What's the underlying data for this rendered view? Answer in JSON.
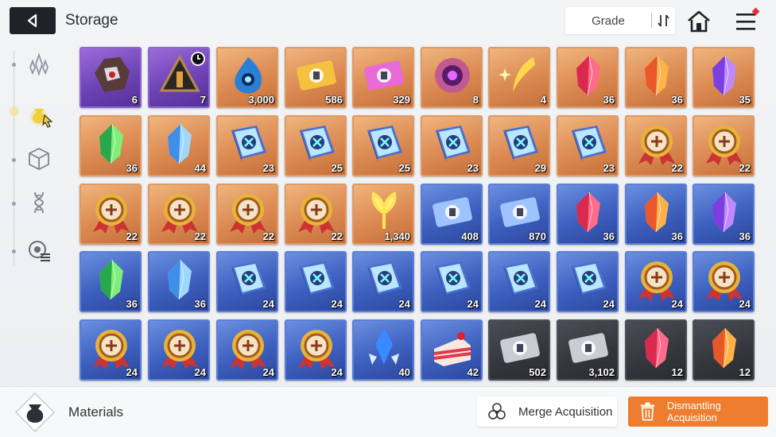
{
  "header": {
    "title": "Storage",
    "sort_label": "Grade"
  },
  "sidebar": {
    "tabs": [
      {
        "icon": "crystal-cluster-icon"
      },
      {
        "icon": "material-pouch-icon",
        "active": true
      },
      {
        "icon": "cube-icon"
      },
      {
        "icon": "dna-icon"
      },
      {
        "icon": "planet-ring-icon"
      }
    ]
  },
  "inventory": {
    "rows": [
      [
        {
          "icon": "ore-rock-icon",
          "grade": "purple",
          "count": "6"
        },
        {
          "icon": "triangle-device-icon",
          "grade": "purple",
          "count": "7",
          "timed": true
        },
        {
          "icon": "blue-flame-icon",
          "grade": "orange",
          "count": "3,000"
        },
        {
          "icon": "gold-ticket-icon",
          "grade": "orange",
          "count": "586"
        },
        {
          "icon": "rainbow-ticket-icon",
          "grade": "orange",
          "count": "329"
        },
        {
          "icon": "eye-orb-icon",
          "grade": "orange",
          "count": "8"
        },
        {
          "icon": "gold-feather-icon",
          "grade": "orange",
          "count": "4"
        },
        {
          "icon": "crystal-red-icon",
          "grade": "orange",
          "count": "36"
        },
        {
          "icon": "crystal-orange-icon",
          "grade": "orange",
          "count": "36"
        },
        {
          "icon": "crystal-purple-icon",
          "grade": "orange",
          "count": "35"
        }
      ],
      [
        {
          "icon": "crystal-green-icon",
          "grade": "orange",
          "count": "36"
        },
        {
          "icon": "crystal-blue-icon",
          "grade": "orange",
          "count": "44"
        },
        {
          "icon": "skill-book-swords-icon",
          "grade": "orange",
          "count": "23"
        },
        {
          "icon": "skill-book-shield-icon",
          "grade": "orange",
          "count": "25"
        },
        {
          "icon": "skill-book-eye-icon",
          "grade": "orange",
          "count": "25"
        },
        {
          "icon": "skill-book-bow-icon",
          "grade": "orange",
          "count": "23"
        },
        {
          "icon": "skill-book-blade-icon",
          "grade": "orange",
          "count": "29"
        },
        {
          "icon": "skill-book-orb-icon",
          "grade": "orange",
          "count": "23"
        },
        {
          "icon": "medal-cross-icon",
          "grade": "orange",
          "count": "22"
        },
        {
          "icon": "medal-shield-icon",
          "grade": "orange",
          "count": "22"
        }
      ],
      [
        {
          "icon": "medal-eye-icon",
          "grade": "orange",
          "count": "22"
        },
        {
          "icon": "medal-bow-icon",
          "grade": "orange",
          "count": "22"
        },
        {
          "icon": "medal-blade-icon",
          "grade": "orange",
          "count": "22"
        },
        {
          "icon": "medal-orb-icon",
          "grade": "orange",
          "count": "22"
        },
        {
          "icon": "gold-sprout-icon",
          "grade": "orange",
          "count": "1,340"
        },
        {
          "icon": "silver-ticket-icon",
          "grade": "blue",
          "count": "408"
        },
        {
          "icon": "star-ticket-icon",
          "grade": "blue",
          "count": "870"
        },
        {
          "icon": "crystal-red-icon",
          "grade": "blue",
          "count": "36"
        },
        {
          "icon": "crystal-orange-icon",
          "grade": "blue",
          "count": "36"
        },
        {
          "icon": "crystal-purple-icon",
          "grade": "blue",
          "count": "36"
        }
      ],
      [
        {
          "icon": "crystal-green-icon",
          "grade": "blue",
          "count": "36"
        },
        {
          "icon": "crystal-blue-icon",
          "grade": "blue",
          "count": "36"
        },
        {
          "icon": "skill-book-swords-icon",
          "grade": "blue",
          "count": "24"
        },
        {
          "icon": "skill-book-shield-icon",
          "grade": "blue",
          "count": "24"
        },
        {
          "icon": "skill-book-eye-icon",
          "grade": "blue",
          "count": "24"
        },
        {
          "icon": "skill-book-bow-icon",
          "grade": "blue",
          "count": "24"
        },
        {
          "icon": "skill-book-blade-icon",
          "grade": "blue",
          "count": "24"
        },
        {
          "icon": "skill-book-orb-icon",
          "grade": "blue",
          "count": "24"
        },
        {
          "icon": "medal-cross-icon",
          "grade": "blue",
          "count": "24"
        },
        {
          "icon": "medal-shield-icon",
          "grade": "blue",
          "count": "24"
        }
      ],
      [
        {
          "icon": "medal-eye-icon",
          "grade": "blue",
          "count": "24"
        },
        {
          "icon": "medal-bow-icon",
          "grade": "blue",
          "count": "24"
        },
        {
          "icon": "medal-blade-icon",
          "grade": "blue",
          "count": "24"
        },
        {
          "icon": "medal-orb-icon",
          "grade": "blue",
          "count": "24"
        },
        {
          "icon": "blue-crystal-shard-icon",
          "grade": "blue",
          "count": "40"
        },
        {
          "icon": "cake-slice-icon",
          "grade": "blue",
          "count": "42"
        },
        {
          "icon": "grey-ticket-icon",
          "grade": "dark",
          "count": "502"
        },
        {
          "icon": "grey-star-ticket-icon",
          "grade": "dark",
          "count": "3,102"
        },
        {
          "icon": "crystal-red-icon",
          "grade": "dark",
          "count": "12"
        },
        {
          "icon": "crystal-orange-icon",
          "grade": "dark",
          "count": "12"
        }
      ]
    ]
  },
  "footer": {
    "category_label": "Materials",
    "merge_label": "Merge Acquisition",
    "dismantle_label": "Dismantling Acquisition"
  },
  "colors": {
    "purple": "#7a4fc4",
    "orange": "#db8a52",
    "blue": "#3d5fbe",
    "dark": "#34363c",
    "accent": "#ee7d2f",
    "notification": "#e4303a"
  }
}
